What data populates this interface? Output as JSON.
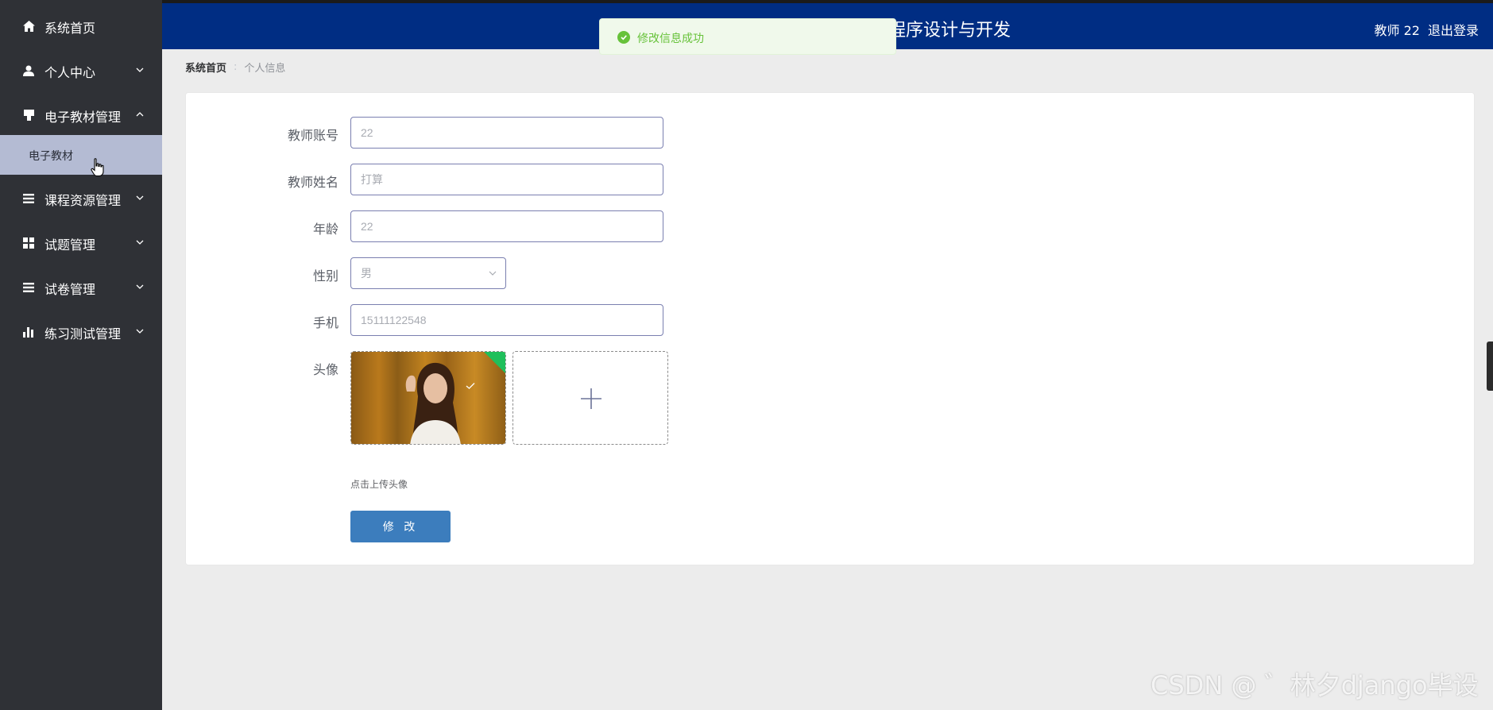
{
  "header": {
    "title": "程序设计与开发",
    "user": "教师 22",
    "logout": "退出登录"
  },
  "toast": {
    "message": "修改信息成功",
    "color": "#67c23a"
  },
  "sidebar": {
    "items": [
      {
        "label": "系统首页",
        "icon": "home-icon",
        "expanded": false,
        "has_arrow": false
      },
      {
        "label": "个人中心",
        "icon": "user-icon",
        "expanded": false,
        "has_arrow": true
      },
      {
        "label": "电子教材管理",
        "icon": "book-icon",
        "expanded": true,
        "has_arrow": true
      },
      {
        "label": "课程资源管理",
        "icon": "list-icon",
        "expanded": false,
        "has_arrow": true
      },
      {
        "label": "试题管理",
        "icon": "grid-icon",
        "expanded": false,
        "has_arrow": true
      },
      {
        "label": "试卷管理",
        "icon": "list-icon",
        "expanded": false,
        "has_arrow": true
      },
      {
        "label": "练习测试管理",
        "icon": "bar-chart-icon",
        "expanded": false,
        "has_arrow": true
      }
    ],
    "submenu": {
      "label": "电子教材",
      "active": true
    }
  },
  "breadcrumb": {
    "home": "系统首页",
    "current": "个人信息"
  },
  "form": {
    "account": {
      "label": "教师账号",
      "value": "22"
    },
    "name": {
      "label": "教师姓名",
      "value": "打算"
    },
    "age": {
      "label": "年龄",
      "value": "22"
    },
    "gender": {
      "label": "性别",
      "value": "男"
    },
    "phone": {
      "label": "手机",
      "value": "15111122548"
    },
    "avatar": {
      "label": "头像",
      "tip": "点击上传头像"
    },
    "submit": "修 改"
  },
  "watermark": "CSDN @ ゛林夕django毕设",
  "colors": {
    "sidebar_bg": "#2f3136",
    "header_bg": "#002d83",
    "submenu_active_bg": "#b4bbd3",
    "button_bg": "#3c7dbd"
  }
}
